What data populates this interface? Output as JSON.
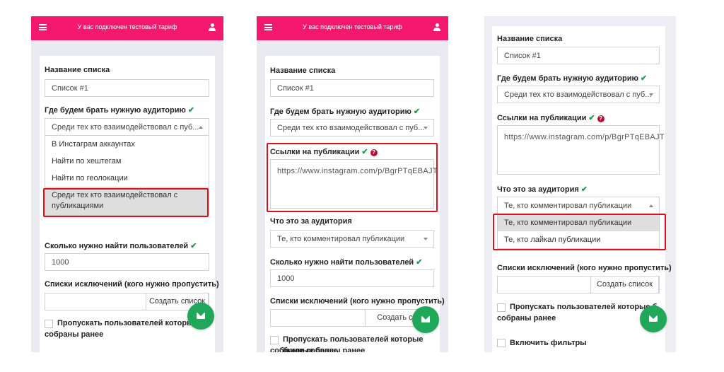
{
  "colors": {
    "topbar": "#f4196e",
    "check": "#1a9b4b",
    "fab": "#1fa75a",
    "highlight": "#e0101b"
  },
  "topbar": {
    "tariff_text": "У вас подключен тестовый тариф",
    "menu_icon": "hamburger-icon",
    "user_icon": "user-icon"
  },
  "form": {
    "list_name_label": "Название списка",
    "list_name_value": "Список #1",
    "audience_label": "Где будем брать нужную аудиторию",
    "audience_value": "Среди тех кто взаимодействовал с пуб...",
    "audience_options": [
      "В Инстаграм аккаунтах",
      "Найти по хештегам",
      "Найти по геолокации",
      "Среди тех кто взаимодействовал с публикациями"
    ],
    "links_label": "Ссылки на публикации",
    "links_value": "https://www.instagram.com/p/BgrPTqEBAJT",
    "what_audience_label": "Что это за аудитория",
    "what_audience_value": "Те, кто комментировал публикации",
    "what_audience_options": [
      "Те, кто комментировал публикации",
      "Те, кто лайкал публикации"
    ],
    "how_many_label": "Сколько нужно найти пользователей",
    "how_many_value": "1000",
    "exclusions_label": "Списки исключений (кого нужно пропустить)",
    "create_list_button": "Создать список",
    "create_list_button_cut": "Создать спи",
    "skip_collected_label": "Пропускать пользователей которые были собраны ранее",
    "skip_collected_label_s1": "Пропускать пользователей которые б",
    "skip_collected_label_s1_b": "собраны ранее",
    "skip_collected_label_s2_b": "собранные ранее",
    "skip_collected_label_s3": "Пропускать пользователей которые б",
    "skip_collected_label_s3_b": "собраны ранее",
    "filters_label": "Включить фильтры"
  }
}
